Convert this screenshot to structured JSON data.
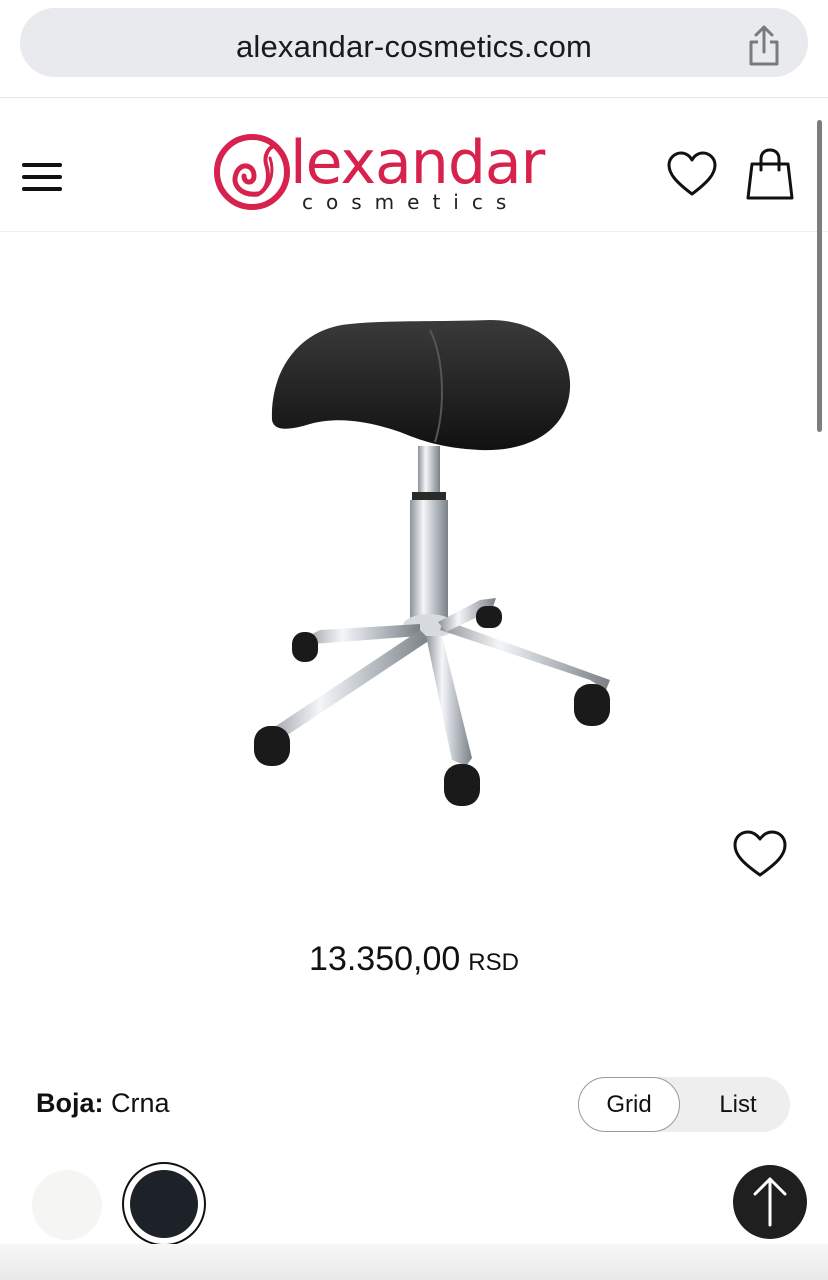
{
  "browser": {
    "url": "alexandar-cosmetics.com"
  },
  "header": {
    "logo_text": "lexandar",
    "logo_subtext": "cosmetics"
  },
  "product": {
    "price_value": "13.350,00",
    "price_currency": "RSD",
    "color_label": "Boja:",
    "color_value": "Crna",
    "view_toggle": {
      "grid_label": "Grid",
      "list_label": "List",
      "selected": "Grid"
    },
    "swatches": [
      {
        "color": "#f5f5f3",
        "selected": false
      },
      {
        "color": "#1d2229",
        "selected": true
      }
    ]
  },
  "colors": {
    "brand": "#d6224d",
    "dark": "#1f1f1f"
  }
}
